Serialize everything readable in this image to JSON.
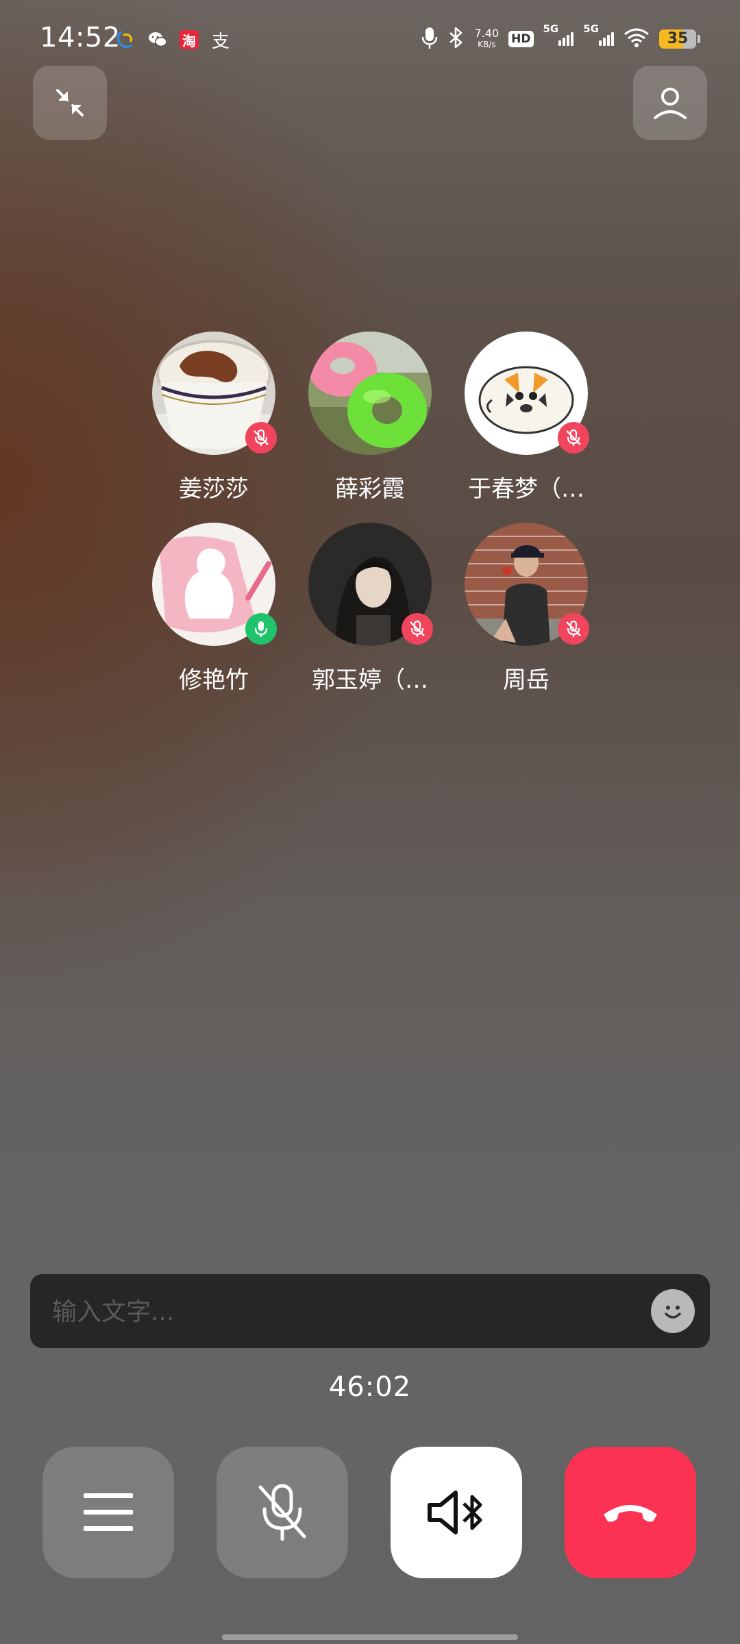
{
  "status_bar": {
    "time": "14:52",
    "net_speed_value": "7.40",
    "net_speed_unit": "KB/s",
    "hd": "HD",
    "signal1": "5G",
    "signal2": "5G",
    "battery": "35",
    "app_icons": [
      "chat-bubble-app-icon",
      "wechat-icon",
      "taobao-icon",
      "alipay-icon"
    ],
    "system_icons": [
      "microphone-icon",
      "bluetooth-icon",
      "wifi-icon"
    ],
    "app_icon_taobao_text": "淘",
    "app_icon_alipay_text": "支"
  },
  "top": {
    "minimize_icon": "minimize-arrows-icon",
    "add_member_icon": "person-icon"
  },
  "participants": [
    {
      "name": "姜莎莎",
      "mic": "muted",
      "avatar": "coffee-cup"
    },
    {
      "name": "薛彩霞",
      "mic": "none",
      "avatar": "pool-floats"
    },
    {
      "name": "于春梦（…",
      "mic": "muted",
      "avatar": "tiger-cartoon"
    },
    {
      "name": "修艳竹",
      "mic": "on",
      "avatar": "pink-silhouette"
    },
    {
      "name": "郭玉婷（…",
      "mic": "muted",
      "avatar": "woman-portrait"
    },
    {
      "name": "周岳",
      "mic": "muted",
      "avatar": "man-brick-wall"
    }
  ],
  "message": {
    "placeholder": "输入文字...",
    "value": ""
  },
  "call": {
    "duration": "46:02"
  },
  "controls": {
    "menu_icon": "menu-icon",
    "mute_icon": "mic-off-icon",
    "speaker_icon": "speaker-bluetooth-icon",
    "hangup_icon": "hang-up-icon"
  },
  "colors": {
    "muted_badge": "#f0455c",
    "mic_on_badge": "#1fc46a",
    "hangup": "#fc3254",
    "battery": "#f5b820"
  }
}
